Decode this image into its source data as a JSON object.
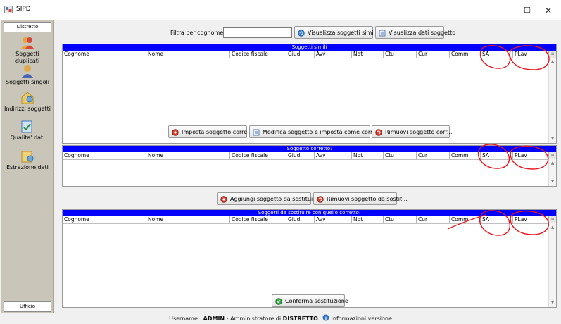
{
  "window": {
    "title": "SIPD",
    "min_icon": "minimize-icon",
    "max_icon": "maximize-icon",
    "close_icon": "close-icon"
  },
  "sidebar": {
    "top_tab": "Distretto",
    "items": [
      {
        "label_line1": "Soggetti",
        "label_line2": "duplicati",
        "icon": "users-icon"
      },
      {
        "label_line1": "Soggetti singoli",
        "label_line2": "",
        "icon": "user-icon"
      },
      {
        "label_line1": "Indirizzi soggetti",
        "label_line2": "",
        "icon": "address-icon"
      },
      {
        "label_line1": "Qualita' dati",
        "label_line2": "",
        "icon": "quality-icon"
      },
      {
        "label_line1": "Estrazione dati",
        "label_line2": "",
        "icon": "extract-icon"
      }
    ],
    "bottom_tab": "Ufficio"
  },
  "filter": {
    "label": "Filtra per cognome:",
    "value": "",
    "placeholder": ""
  },
  "buttons": {
    "show_similar": "Visualizza soggetti simili",
    "show_data": "Visualizza dati soggetto",
    "set_correct": "Imposta soggetto corre...",
    "modify_set_correct": "Modifica soggetto e imposta come corretto",
    "remove_correct": "Rimuovi soggetto corr...",
    "add_replace": "Aggiungi soggetto da sostituire",
    "remove_replace": "Rimuovi soggetto da sostit...",
    "confirm": "Conferma sostituzione"
  },
  "columns": [
    "Cognome",
    "Nome",
    "Codice fiscale",
    "Giud",
    "Avv",
    "Not",
    "Ctu",
    "Cur",
    "Comm",
    "SA",
    "PLav"
  ],
  "grids": {
    "similar": {
      "title": "Soggetti simili",
      "rows": []
    },
    "correct": {
      "title": "Soggetto corretto:",
      "rows": []
    },
    "replace": {
      "title": "Soggetti da sostituire con quello corretto:",
      "rows": []
    }
  },
  "status": {
    "prefix": "Username : ",
    "username": "ADMIN",
    "sep": " - Amministratore di ",
    "role": "DISTRETTO",
    "info_label": "Informazioni versione"
  },
  "colors": {
    "header_blue": "#0000ff",
    "annotation_red": "#e8141c",
    "sidebar_bg": "#c9c6b9"
  }
}
